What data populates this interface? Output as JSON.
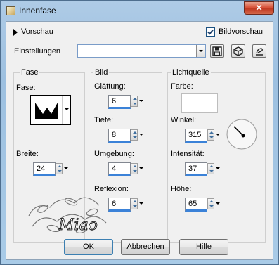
{
  "window": {
    "title": "Innenfase"
  },
  "preview": {
    "label": "Vorschau",
    "bild_label": "Bildvorschau",
    "bild_checked": true
  },
  "settings": {
    "label": "Einstellungen",
    "value": ""
  },
  "fase_group": {
    "title": "Fase",
    "fase_label": "Fase:",
    "breite_label": "Breite:",
    "breite_value": "24"
  },
  "bild_group": {
    "title": "Bild",
    "glaettung_label": "Glättung:",
    "glaettung_value": "6",
    "tiefe_label": "Tiefe:",
    "tiefe_value": "8",
    "umgebung_label": "Umgebung:",
    "umgebung_value": "4",
    "reflexion_label": "Reflexion:",
    "reflexion_value": "6"
  },
  "licht_group": {
    "title": "Lichtquelle",
    "farbe_label": "Farbe:",
    "farbe_color": "#ffffff",
    "winkel_label": "Winkel:",
    "winkel_value": "315",
    "intensitaet_label": "Intensität:",
    "intensitaet_value": "37",
    "hoehe_label": "Höhe:",
    "hoehe_value": "65"
  },
  "buttons": {
    "ok": "OK",
    "cancel": "Abbrechen",
    "help": "Hilfe"
  },
  "icons": {
    "save": "floppy-disk-icon",
    "load": "cube-icon",
    "reset": "pen-icon",
    "close": "close-icon",
    "watermark": "decorative-watermark-icon"
  },
  "colors": {
    "accent": "#3b82d8",
    "title_bg": "#a9cbe7",
    "close_btn": "#d8533a"
  }
}
